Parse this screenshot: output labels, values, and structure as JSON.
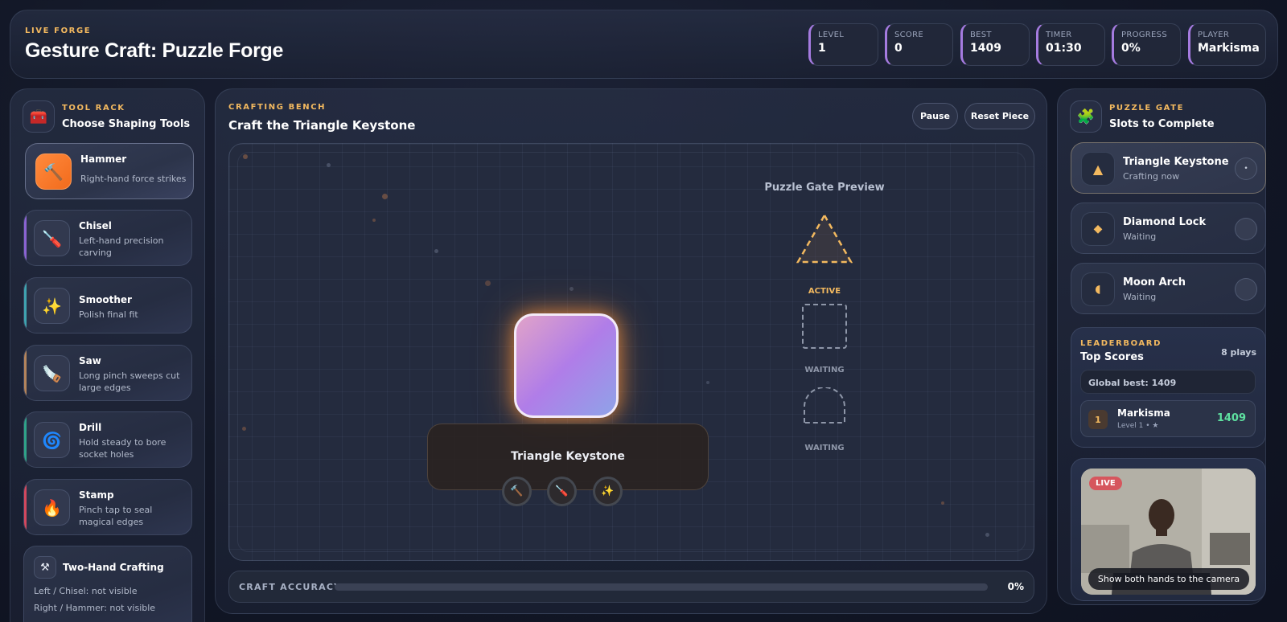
{
  "header": {
    "eyebrow": "LIVE FORGE",
    "title": "Gesture Craft: Puzzle Forge",
    "stats": [
      {
        "label": "LEVEL",
        "value": "1"
      },
      {
        "label": "SCORE",
        "value": "0"
      },
      {
        "label": "BEST",
        "value": "1409"
      },
      {
        "label": "TIMER",
        "value": "01:30"
      },
      {
        "label": "PROGRESS",
        "value": "0%"
      },
      {
        "label": "PLAYER",
        "value": "Markisma"
      }
    ]
  },
  "tool_rack": {
    "eyebrow": "TOOL RACK",
    "title": "Choose Shaping Tools",
    "icon": "toolbox-icon",
    "tools": [
      {
        "name": "Hammer",
        "desc": "Right-hand force strikes",
        "icon": "hammer-icon",
        "glyph": "🔨",
        "accent": "#ff8a3d",
        "active": true
      },
      {
        "name": "Chisel",
        "desc": "Left-hand precision carving",
        "icon": "chisel-icon",
        "glyph": "🪛",
        "accent": "#8a63d2"
      },
      {
        "name": "Smoother",
        "desc": "Polish final fit",
        "icon": "sparkles-icon",
        "glyph": "✨",
        "accent": "#3fa3b0"
      },
      {
        "name": "Saw",
        "desc": "Long pinch sweeps cut large edges",
        "icon": "saw-icon",
        "glyph": "🪚",
        "accent": "#b3845c"
      },
      {
        "name": "Drill",
        "desc": "Hold steady to bore socket holes",
        "icon": "drill-icon",
        "glyph": "🌀",
        "accent": "#2fa389"
      },
      {
        "name": "Stamp",
        "desc": "Pinch tap to seal magical edges",
        "icon": "stamp-icon",
        "glyph": "🔥",
        "accent": "#d2485e"
      }
    ],
    "two_hand": {
      "title": "Two-Hand Crafting",
      "icon": "crossed-tools-icon",
      "left_status": "Left / Chisel: not visible",
      "right_status": "Right / Hammer: not visible"
    }
  },
  "bench": {
    "eyebrow": "CRAFTING BENCH",
    "title": "Craft the Triangle Keystone",
    "pause_label": "Pause",
    "reset_label": "Reset Piece",
    "piece_label": "Triangle Keystone",
    "piece_tools": [
      "hammer-icon",
      "chisel-icon",
      "sparkles-icon"
    ],
    "preview": {
      "title": "Puzzle Gate Preview",
      "slots": [
        {
          "shape": "triangle",
          "status": "ACTIVE",
          "color": "#f3b95f"
        },
        {
          "shape": "square",
          "status": "WAITING",
          "color": "#8e96a8"
        },
        {
          "shape": "arch",
          "status": "WAITING",
          "color": "#8e96a8"
        }
      ]
    },
    "accuracy": {
      "label": "CRAFT ACCURACY",
      "value": "0%",
      "fraction": 0
    }
  },
  "puzzle_gate": {
    "eyebrow": "PUZZLE GATE",
    "title": "Slots to Complete",
    "icon": "puzzle-icon",
    "slots": [
      {
        "name": "Triangle Keystone",
        "status": "Crafting now",
        "icon": "triangle-icon",
        "glyph": "▲",
        "check": "•",
        "active": true
      },
      {
        "name": "Diamond Lock",
        "status": "Waiting",
        "icon": "diamond-icon",
        "glyph": "◆",
        "check": ""
      },
      {
        "name": "Moon Arch",
        "status": "Waiting",
        "icon": "half-moon-icon",
        "glyph": "◖",
        "check": ""
      }
    ]
  },
  "leaderboard": {
    "eyebrow": "LEADERBOARD",
    "title": "Top Scores",
    "plays": "8 plays",
    "global_best": "Global best:  1409",
    "entries": [
      {
        "rank": "1",
        "name": "Markisma",
        "meta": "Level 1 • ★",
        "score": "1409"
      }
    ]
  },
  "camera": {
    "badge": "LIVE",
    "caption": "Show both hands to the camera"
  },
  "colors": {
    "accent": "#f3b95f",
    "score_green": "#5ee0a0",
    "stat_border": "#a57be0"
  }
}
